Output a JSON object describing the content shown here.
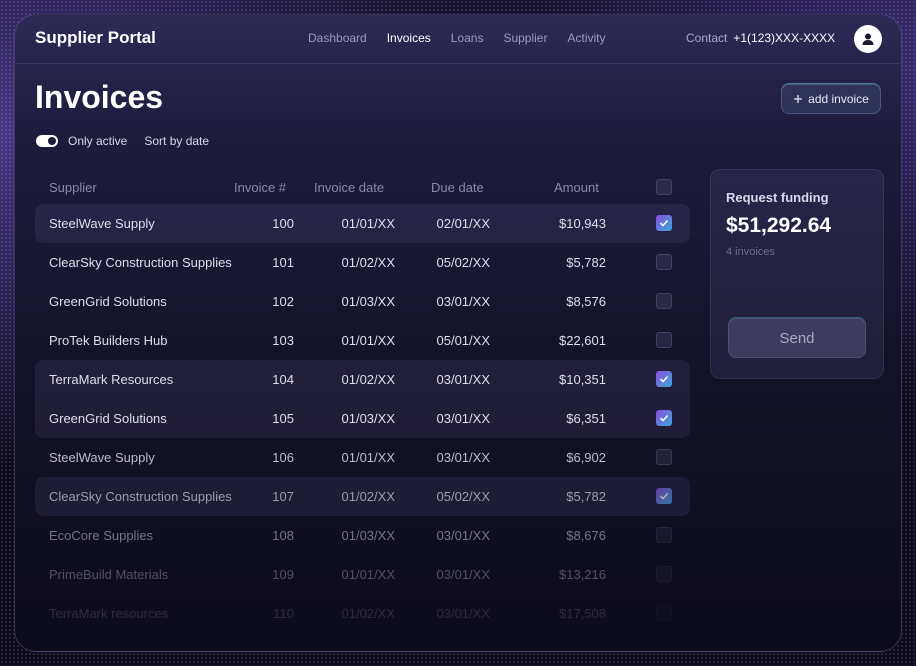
{
  "header": {
    "brand": "Supplier Portal",
    "nav": [
      "Dashboard",
      "Invoices",
      "Loans",
      "Supplier",
      "Activity"
    ],
    "active_nav": "Invoices",
    "contact_label": "Contact",
    "contact_phone": "+1(123)XXX-XXXX"
  },
  "page": {
    "title": "Invoices",
    "add_button": "add invoice",
    "filter_only_active": "Only active",
    "filter_only_active_on": true,
    "sort_label": "Sort by date"
  },
  "table": {
    "columns": [
      "Supplier",
      "Invoice #",
      "Invoice date",
      "Due date",
      "Amount"
    ],
    "rows": [
      {
        "supplier": "SteelWave Supply",
        "num": "100",
        "invoice_date": "01/01/XX",
        "due_date": "02/01/XX",
        "amount": "$10,943",
        "checked": true
      },
      {
        "supplier": "ClearSky Construction Supplies",
        "num": "101",
        "invoice_date": "01/02/XX",
        "due_date": "05/02/XX",
        "amount": "$5,782",
        "checked": false
      },
      {
        "supplier": "GreenGrid Solutions",
        "num": "102",
        "invoice_date": "01/03/XX",
        "due_date": "03/01/XX",
        "amount": "$8,576",
        "checked": false
      },
      {
        "supplier": "ProTek Builders Hub",
        "num": "103",
        "invoice_date": "01/01/XX",
        "due_date": "05/01/XX",
        "amount": "$22,601",
        "checked": false
      },
      {
        "supplier": "TerraMark Resources",
        "num": "104",
        "invoice_date": "01/02/XX",
        "due_date": "03/01/XX",
        "amount": "$10,351",
        "checked": true
      },
      {
        "supplier": "GreenGrid Solutions",
        "num": "105",
        "invoice_date": "01/03/XX",
        "due_date": "03/01/XX",
        "amount": "$6,351",
        "checked": true
      },
      {
        "supplier": "SteelWave Supply",
        "num": "106",
        "invoice_date": "01/01/XX",
        "due_date": "03/01/XX",
        "amount": "$6,902",
        "checked": false
      },
      {
        "supplier": "ClearSky Construction Supplies",
        "num": "107",
        "invoice_date": "01/02/XX",
        "due_date": "05/02/XX",
        "amount": "$5,782",
        "checked": true
      },
      {
        "supplier": "EcoCore Supplies",
        "num": "108",
        "invoice_date": "01/03/XX",
        "due_date": "03/01/XX",
        "amount": "$8,676",
        "checked": false
      },
      {
        "supplier": "PrimeBuild Materials",
        "num": "109",
        "invoice_date": "01/01/XX",
        "due_date": "03/01/XX",
        "amount": "$13,216",
        "checked": false
      },
      {
        "supplier": "TerraMark resources",
        "num": "110",
        "invoice_date": "01/02/XX",
        "due_date": "03/01/XX",
        "amount": "$17,508",
        "checked": false
      }
    ]
  },
  "funding": {
    "label": "Request funding",
    "total": "$51,292.64",
    "count": "4 invoices",
    "send_label": "Send"
  },
  "colors": {
    "accent_gradient_start": "#8a4ee0",
    "accent_gradient_end": "#3aa8d8",
    "glow": "#5adce6"
  },
  "icons": [
    "plus-icon",
    "user-icon",
    "check-icon"
  ]
}
